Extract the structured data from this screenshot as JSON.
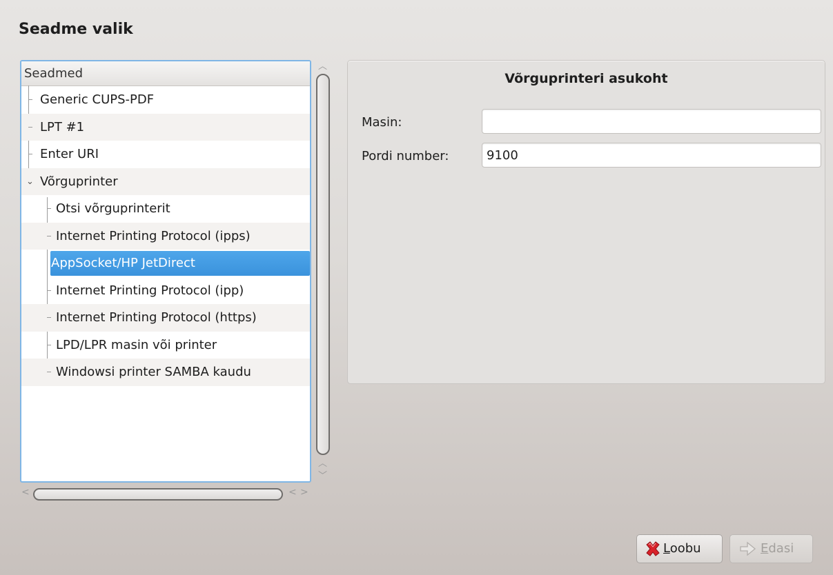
{
  "page": {
    "title": "Seadme valik"
  },
  "tree": {
    "header": "Seadmed",
    "items": [
      {
        "label": "Generic CUPS-PDF"
      },
      {
        "label": "LPT #1"
      },
      {
        "label": "Enter URI"
      },
      {
        "label": "Võrguprinter",
        "expanded": true,
        "children": [
          {
            "label": "Otsi võrguprinterit"
          },
          {
            "label": "Internet Printing Protocol (ipps)"
          },
          {
            "label": "AppSocket/HP JetDirect",
            "selected": true
          },
          {
            "label": "Internet Printing Protocol (ipp)"
          },
          {
            "label": "Internet Printing Protocol (https)"
          },
          {
            "label": "LPD/LPR masin või printer"
          },
          {
            "label": "Windowsi printer SAMBA kaudu"
          }
        ]
      }
    ]
  },
  "panel": {
    "title": "Võrguprinteri asukoht",
    "host_label": "Masin:",
    "host_value": "",
    "port_label": "Pordi number:",
    "port_value": "9100"
  },
  "buttons": {
    "cancel_mnemonic": "L",
    "cancel_rest": "oobu",
    "next_mnemonic": "E",
    "next_rest": "dasi"
  },
  "colors": {
    "selection": "#3d95de",
    "focus_border": "#7fb6e6",
    "cancel_icon": "#d8222a"
  }
}
